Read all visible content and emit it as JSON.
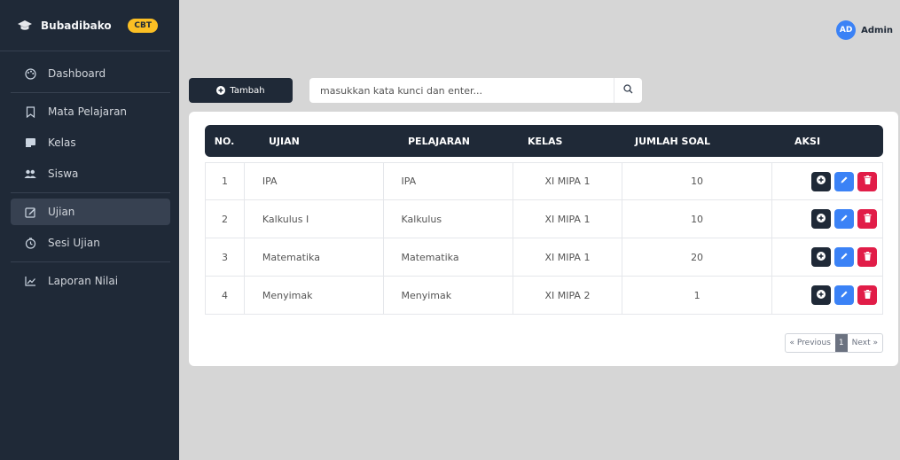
{
  "brand": {
    "name": "Bubadibako",
    "badge": "CBT"
  },
  "user": {
    "initials": "AD",
    "name": "Admin"
  },
  "nav": {
    "dashboard": "Dashboard",
    "mata_pelajaran": "Mata Pelajaran",
    "kelas": "Kelas",
    "siswa": "Siswa",
    "ujian": "Ujian",
    "sesi_ujian": "Sesi Ujian",
    "laporan_nilai": "Laporan Nilai"
  },
  "toolbar": {
    "add_label": "Tambah",
    "search_placeholder": "masukkan kata kunci dan enter..."
  },
  "table": {
    "headers": {
      "no": "NO.",
      "ujian": "UJIAN",
      "pelajaran": "PELAJARAN",
      "kelas": "KELAS",
      "jumlah_soal": "JUMLAH SOAL",
      "aksi": "AKSI"
    },
    "rows": [
      {
        "no": "1",
        "ujian": "IPA",
        "pelajaran": "IPA",
        "kelas": "XI MIPA 1",
        "jumlah_soal": "10"
      },
      {
        "no": "2",
        "ujian": "Kalkulus I",
        "pelajaran": "Kalkulus",
        "kelas": "XI MIPA 1",
        "jumlah_soal": "10"
      },
      {
        "no": "3",
        "ujian": "Matematika",
        "pelajaran": "Matematika",
        "kelas": "XI MIPA 1",
        "jumlah_soal": "20"
      },
      {
        "no": "4",
        "ujian": "Menyimak",
        "pelajaran": "Menyimak",
        "kelas": "XI MIPA 2",
        "jumlah_soal": "1"
      }
    ]
  },
  "pagination": {
    "previous": "« Previous",
    "current": "1",
    "next": "Next »"
  },
  "colors": {
    "sidebar": "#1f2937",
    "accent_blue": "#3b82f6",
    "danger": "#e11d48",
    "badge": "#fbbf24"
  }
}
